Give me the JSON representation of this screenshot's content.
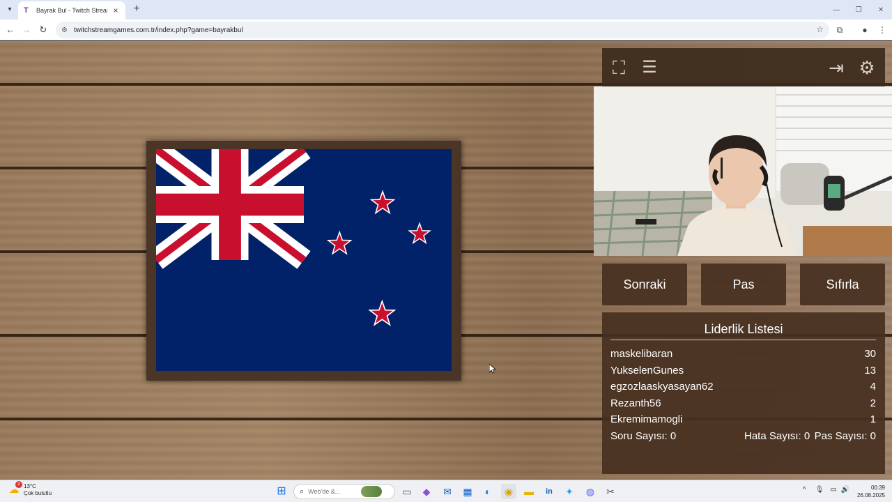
{
  "browser": {
    "tab_title": "Bayrak Bul - Twitch Stream Gam",
    "url": "twitchstreamgames.com.tr/index.php?game=bayrakbul"
  },
  "game": {
    "flag": {
      "name": "New Zealand",
      "colors": {
        "blue": "#012169",
        "red": "#c8102e",
        "white": "#ffffff"
      }
    },
    "top_panel": {
      "icons": [
        "fullscreen-icon",
        "notes-icon",
        "exit-icon",
        "gear-icon"
      ]
    },
    "buttons": {
      "next": "Sonraki",
      "pass": "Pas",
      "reset": "Sıfırla"
    },
    "leaderboard": {
      "title": "Liderlik Listesi",
      "rows": [
        {
          "name": "maskelibaran",
          "score": "30"
        },
        {
          "name": "YukselenGunes",
          "score": "13"
        },
        {
          "name": "egzozlaaskyasayan62",
          "score": "4"
        },
        {
          "name": "Rezanth56",
          "score": "2"
        },
        {
          "name": "Ekremimamogli",
          "score": "1"
        }
      ],
      "stats": {
        "questions": "Soru Sayısı: 0",
        "errors": "Hata Sayısı: 0",
        "passes": "Pas Sayısı: 0"
      }
    }
  },
  "taskbar": {
    "weather_temp": "13°C",
    "weather_desc": "Çok bulutlu",
    "weather_badge": "2",
    "search_placeholder": "Web'de &...",
    "time": "00:39",
    "date": "26.08.2025"
  }
}
